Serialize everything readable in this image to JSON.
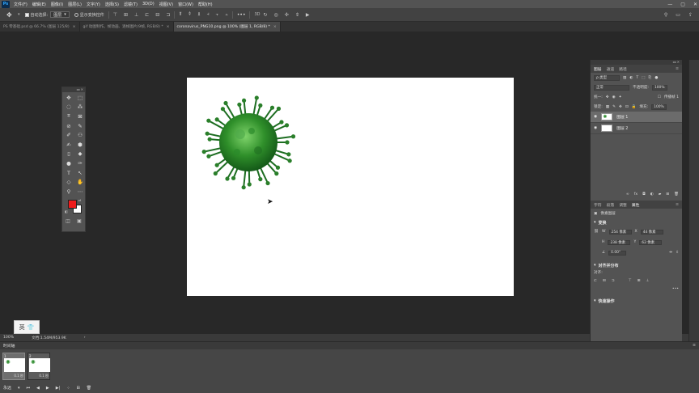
{
  "app": {
    "logo": "Ps"
  },
  "menu": [
    "文件(F)",
    "编辑(E)",
    "图像(I)",
    "图层(L)",
    "文字(Y)",
    "选择(S)",
    "滤镜(T)",
    "3D(D)",
    "视图(V)",
    "窗口(W)",
    "帮助(H)"
  ],
  "window_controls": [
    "—",
    "▢",
    "✕"
  ],
  "options": {
    "auto_select_label": "自动选择:",
    "auto_select_value": "图层",
    "show_transform_label": "显示变换控件",
    "more": "•••"
  },
  "tabs": [
    {
      "label": "PS 零基础.psd @ 66.7% (图层 125/8)",
      "active": false
    },
    {
      "label": "gif 动图制作。帧动画、逐帧图片(9帧, RGB/8) *",
      "active": false
    },
    {
      "label": "coronavirus_PNG10.png @ 100% (图层 1, RGB/8) *",
      "active": true
    }
  ],
  "tools": [
    "✥",
    "⬚",
    "◌",
    "⁂",
    "⌗",
    "⊠",
    "⊘",
    "✎",
    "✐",
    "⚇",
    "✍",
    "⬢",
    "▯",
    "◆",
    "●",
    "✑",
    "T",
    "↖",
    "◇",
    "✋",
    "⚲",
    "⋯"
  ],
  "colors": {
    "foreground": "#ee1c1c",
    "background": "#ffffff",
    "accent_green": "#2e8b2e",
    "panel": "#535353"
  },
  "ime": {
    "label": "英",
    "shirt_icon": "shirt-icon"
  },
  "status": {
    "zoom": "100%",
    "doc": "文档:1.54M/953.9K"
  },
  "layers_panel": {
    "tabs": [
      "图层",
      "通道",
      "路径"
    ],
    "filter_label": "ρ 类型",
    "blend_mode": "正常",
    "opacity_label": "不透明度:",
    "opacity_value": "100%",
    "lock_label": "锁定:",
    "fill_label": "填充:",
    "fill_value": "100%",
    "propagate_label": "传播帧 1",
    "unify_label": "统一:",
    "layers": [
      {
        "name": "图层 1",
        "selected": true
      },
      {
        "name": "图层 2",
        "selected": false
      }
    ]
  },
  "properties_panel": {
    "tabs": [
      "字符",
      "段落",
      "调整",
      "属性"
    ],
    "type_label": "像素图层",
    "transform_title": "变换",
    "w_label": "W",
    "w_value": "254 像素",
    "x_label": "X",
    "x_value": "44 像素",
    "h_label": "H",
    "h_value": "238 像素",
    "y_label": "Y",
    "y_value": "62 像素",
    "angle_value": "0.00°",
    "align_title": "对齐并分布",
    "align_label": "对齐:",
    "quick_title": "快速操作"
  },
  "timeline": {
    "title": "时间轴",
    "frames": [
      {
        "number": "1",
        "duration": "0.1 秒",
        "selected": true
      },
      {
        "number": "2",
        "duration": "0.1 秒",
        "selected": false
      }
    ],
    "loop": "永远"
  }
}
